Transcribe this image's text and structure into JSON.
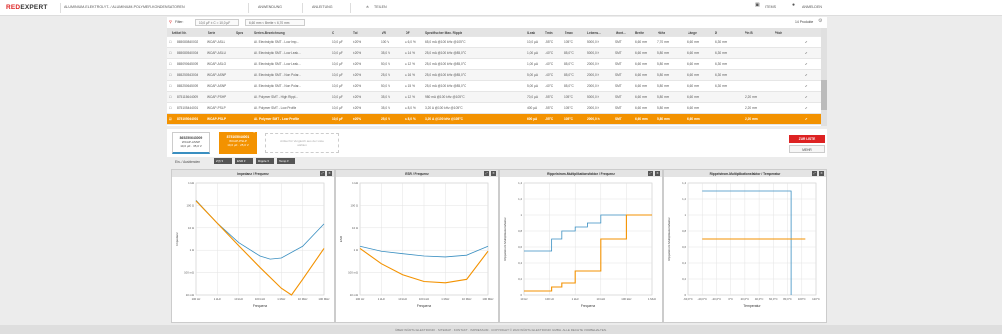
{
  "header": {
    "logo_a": "RED",
    "logo_b": "EXPERT",
    "nav": [
      "ALUMINIUM-ELEKTROLYT- / ALUMINIUM-POLYMER-KONDENSATOREN",
      "ANWENDUNG",
      "ANLEITUNG",
      "TEILEN"
    ],
    "items_label": "ITEMS",
    "login_label": "ANMELDEN"
  },
  "filter": {
    "label": "Filter:",
    "chips": [
      "10,0 µF ± C = 10,0 µF",
      "6,60 mm < Breite < 6,70 mm"
    ],
    "count": "14 Produkte"
  },
  "table": {
    "headers": [
      "Artikel Nr.",
      "Serie",
      "Spez",
      "Serien-Bezeichnung",
      "C",
      "",
      "Tol",
      "VR",
      "DF",
      "Spezifischer Max. Ripple",
      "ILeak",
      "Tmin",
      "Tmax",
      "Lebens...",
      "Mont...",
      "Breite",
      "",
      "Höhe",
      "Länge",
      "Ø",
      "Pin B",
      "Pitch",
      "RoHS"
    ],
    "rows": [
      [
        "865080840002",
        "WCAP-ASLL",
        "",
        "Al. Electrolytic SMT - Low Imp...",
        "10,0 µF",
        "±20%",
        "100 V",
        "≤ 6,0 %",
        "65,0 mA @100 kHz @105°C",
        "10,0 µA",
        "-55°C",
        "105°C",
        "5000,0 h",
        "SMT",
        "6,60 mm",
        "7,70 mm",
        "6,60 mm",
        "6,30 mm",
        "",
        "",
        "✔"
      ],
      [
        "865080540004",
        "WCAP-ASLU",
        "",
        "Al. Electrolytic SMT - Low Leak...",
        "10,0 µF",
        "±20%",
        "35,0 V",
        "≤ 14 %",
        "25,0 mA @100 kHz @85,0°C",
        "1,00 µA",
        "-40°C",
        "85,0°C",
        "5000,0 h",
        "SMT",
        "6,60 mm",
        "5,80 mm",
        "6,60 mm",
        "6,30 mm",
        "",
        "",
        "✔"
      ],
      [
        "865090645009",
        "WCAP-ASLO",
        "",
        "Al. Electrolytic SMT - Low Leak...",
        "10,0 µF",
        "±20%",
        "50,0 V",
        "≤ 12 %",
        "25,0 mA @100 kHz @85,0°C",
        "1,00 µA",
        "-40°C",
        "85,0°C",
        "2000,0 h",
        "SMT",
        "6,60 mm",
        "5,80 mm",
        "6,60 mm",
        "6,30 mm",
        "",
        "",
        "✔"
      ],
      [
        "865250543004",
        "WCAP-ASNP",
        "",
        "Al. Electrolytic SMT - Non Polar...",
        "10,0 µF",
        "±20%",
        "25,0 V",
        "≤ 16 %",
        "25,0 mA @100 kHz @85,0°C",
        "5,00 µA",
        "-40°C",
        "85,0°C",
        "2000,0 h",
        "SMT",
        "6,60 mm",
        "5,80 mm",
        "6,60 mm",
        "6,30 mm",
        "",
        "",
        "✔"
      ],
      [
        "865250645009",
        "WCAP-ASNP",
        "",
        "Al. Electrolytic SMT - Non Polar...",
        "10,0 µF",
        "±20%",
        "50,0 V",
        "≤ 15 %",
        "25,0 mA @100 kHz @85,0°C",
        "5,00 µA",
        "-40°C",
        "85,0°C",
        "2000,0 h",
        "SMT",
        "6,60 mm",
        "5,80 mm",
        "6,60 mm",
        "6,30 mm",
        "",
        "",
        "✔"
      ],
      [
        "875115644009",
        "WCAP-PSHP",
        "",
        "Al. Polymer SMT - High Rippl...",
        "10,0 µF",
        "±20%",
        "35,0 V",
        "≤ 12 %",
        "980 mA @100 kHz @105°C",
        "70,0 µA",
        "-55°C",
        "105°C",
        "5000,0 h",
        "SMT",
        "6,60 mm",
        "5,80 mm",
        "6,60 mm",
        "",
        "2,20 mm",
        "",
        "✔"
      ],
      [
        "875105444001",
        "WCAP-PSLP",
        "",
        "Al. Polymer SMT - Low Profile",
        "10,0 µF",
        "±20%",
        "35,0 V",
        "≤ 8,0 %",
        "3,20 A @100 kHz @105°C",
        "400 µA",
        "-55°C",
        "105°C",
        "2000,0 h",
        "SMT",
        "6,60 mm",
        "5,80 mm",
        "6,60 mm",
        "",
        "2,20 mm",
        "",
        "✔"
      ],
      [
        "875105044001",
        "WCAP-PSLP",
        "",
        "Al. Polymer SMT - Low Profile",
        "10,0 µF",
        "±20%",
        "25,0 V",
        "≤ 8,0 %",
        "3,20 A @100 kHz @105°C",
        "600 µA",
        "-55°C",
        "105°C",
        "2000,0 h",
        "SMT",
        "6,60 mm",
        "5,80 mm",
        "6,60 mm",
        "",
        "2,20 mm",
        "",
        "✔"
      ]
    ]
  },
  "compare": {
    "cards": [
      {
        "pn": "865250643009",
        "sub": "WCAP-ASNP",
        "val": "10,0 µF · 35,0 V"
      },
      {
        "pn": "875105044001",
        "sub": "WCAP-PSLP",
        "val": "10,0 µF · 25,0 V"
      }
    ],
    "placeholder": "Artikel für Vergleich aus der Liste wählen",
    "to_list": "ZUR LISTE",
    "more": "MEHR"
  },
  "controls": {
    "label": "Ein- / Ausblenden",
    "selects": [
      "Z(f) ▾",
      "ESR ▾",
      "Ripple ▾",
      "Temp ▾"
    ]
  },
  "panels": [
    {
      "title": "Impedanz / Frequenz",
      "xlabel": "Frequenz",
      "ylabel": "Impedanz"
    },
    {
      "title": "ESR / Frequenz",
      "xlabel": "Frequenz",
      "ylabel": "ESR"
    },
    {
      "title": "Rippelstrom-Multiplikationsfaktor / Frequenz",
      "xlabel": "Frequenz",
      "ylabel": "Rippelstrom Multiplikationsfaktor"
    },
    {
      "title": "Rippelstrom-Multiplikationsfaktor / Temperatur",
      "xlabel": "Temperatur",
      "ylabel": "Rippelstrom Multiplikationsfaktor"
    }
  ],
  "footer": "ÜBER WÜRTH ELEKTRONIK · SITEMAP · KONTAKT · IMPRESSUM · COPYRIGHT © 2020 WÜRTH ELEKTRONIK GMBH. ALLE RECHTE VORBEHALTEN.",
  "colors": {
    "orange": "#f39200",
    "blue": "#3a8fc1",
    "red": "#d22222"
  },
  "chart_data": [
    {
      "type": "line",
      "title": "Impedanz / Frequenz",
      "xlabel": "Frequenz",
      "ylabel": "Impedanz",
      "xscale": "log",
      "yscale": "log",
      "x_ticks": [
        "100 Hz",
        "1 kHz",
        "10 kHz",
        "100 kHz",
        "1 MHz",
        "10 MHz",
        "100 MHz"
      ],
      "y_ticks": [
        "1 kΩ",
        "100 Ω",
        "10 Ω",
        "1 Ω",
        "100 mΩ",
        "10 mΩ"
      ],
      "series": [
        {
          "color": "#3a8fc1",
          "x": [
            100,
            1000,
            10000,
            100000,
            300000,
            1000000,
            10000000,
            100000000
          ],
          "y": [
            170,
            16,
            2.2,
            0.55,
            0.4,
            0.45,
            1.5,
            15
          ]
        },
        {
          "color": "#f39200",
          "x": [
            100,
            1000,
            10000,
            100000,
            1000000,
            3000000,
            10000000,
            100000000
          ],
          "y": [
            160,
            16,
            1.6,
            0.17,
            0.02,
            0.01,
            0.05,
            1.2
          ]
        }
      ]
    },
    {
      "type": "line",
      "title": "ESR / Frequenz",
      "xlabel": "Frequenz",
      "ylabel": "ESR",
      "xscale": "log",
      "yscale": "log",
      "x_ticks": [
        "100 Hz",
        "1 kHz",
        "10 kHz",
        "100 kHz",
        "1 MHz",
        "10 MHz",
        "100 MHz"
      ],
      "y_ticks": [
        "1 kΩ",
        "100 Ω",
        "10 Ω",
        "1 Ω",
        "100 mΩ",
        "10 mΩ"
      ],
      "series": [
        {
          "color": "#3a8fc1",
          "x": [
            100,
            1000,
            10000,
            100000,
            1000000,
            10000000,
            100000000
          ],
          "y": [
            1.5,
            0.9,
            0.7,
            0.55,
            0.5,
            0.6,
            1.5
          ]
        },
        {
          "color": "#f39200",
          "x": [
            100,
            1000,
            10000,
            100000,
            1000000,
            10000000,
            100000000
          ],
          "y": [
            1.2,
            0.25,
            0.08,
            0.04,
            0.035,
            0.05,
            0.9
          ]
        }
      ]
    },
    {
      "type": "line",
      "title": "Rippelstrom-Multiplikationsfaktor / Frequenz",
      "xlabel": "Frequenz",
      "ylabel": "Rippelstrom Multiplikationsfaktor",
      "xscale": "log",
      "x_ticks": [
        "10 Hz",
        "100 Hz",
        "1 kHz",
        "10 kHz",
        "100 kHz",
        "1 MHz"
      ],
      "y_ticks": [
        "1,4",
        "1,2",
        "1",
        "0,8",
        "0,6",
        "0,4",
        "0,2",
        "0"
      ],
      "series": [
        {
          "color": "#3a8fc1",
          "x": [
            10,
            50,
            120,
            300,
            1000,
            3000,
            10000,
            100000,
            1000000
          ],
          "y": [
            0.55,
            0.55,
            0.7,
            0.8,
            0.85,
            0.9,
            1.0,
            1.0,
            1.0
          ]
        },
        {
          "color": "#f39200",
          "x": [
            10,
            50,
            120,
            300,
            1000,
            10000,
            100000,
            1000000
          ],
          "y": [
            0.05,
            0.05,
            0.1,
            0.15,
            0.3,
            0.7,
            1.0,
            1.0
          ]
        }
      ]
    },
    {
      "type": "line",
      "title": "Rippelstrom-Multiplikationsfaktor / Temperatur",
      "xlabel": "Temperatur",
      "ylabel": "Rippelstrom Multiplikationsfaktor",
      "x_ticks": [
        "-60,0°C",
        "-40,0°C",
        "-20,0°C",
        "0°C",
        "20,0°C",
        "40,0°C",
        "60,0°C",
        "80,0°C",
        "100°C",
        "120°C"
      ],
      "y_ticks": [
        "1,4",
        "1,2",
        "1",
        "0,8",
        "0,6",
        "0,4",
        "0,2",
        "0"
      ],
      "series": [
        {
          "color": "#3a8fc1",
          "x": [
            -40,
            85,
            85
          ],
          "y": [
            1.3,
            1.3,
            0
          ]
        },
        {
          "color": "#f39200",
          "x": [
            -40,
            105
          ],
          "y": [
            0.7,
            0.7
          ]
        }
      ]
    }
  ]
}
